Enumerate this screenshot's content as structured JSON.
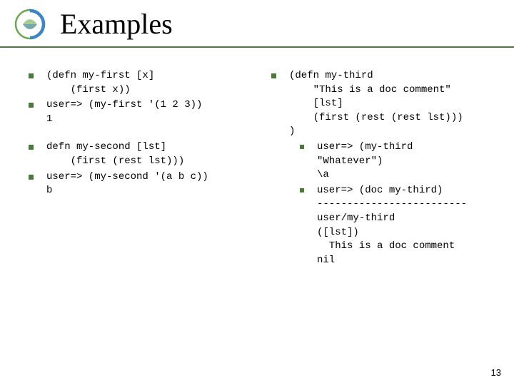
{
  "title": "Examples",
  "left": [
    "(defn my-first [x]\n    (first x))",
    "user=> (my-first '(1 2 3))\n1",
    "defn my-second [lst]\n    (first (rest lst)))",
    "user=> (my-second '(a b c))\nb"
  ],
  "right": [
    "(defn my-third\n    \"This is a doc comment\"\n    [lst]\n    (first (rest (rest lst)))\n)",
    "user=> (my-third\n\"Whatever\")\n\\a",
    "user=> (doc my-third)\n-------------------------\nuser/my-third\n([lst])\n  This is a doc comment\nnil"
  ],
  "page": "13"
}
